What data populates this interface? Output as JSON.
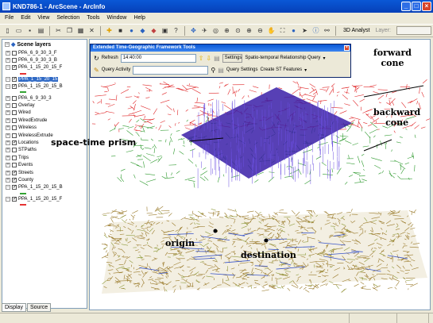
{
  "window": {
    "title": "KND786-1 - ArcScene - ArcInfo"
  },
  "menu": [
    "File",
    "Edit",
    "View",
    "Selection",
    "Tools",
    "Window",
    "Help"
  ],
  "toolbar": {
    "icons": [
      "new-document-icon",
      "open-icon",
      "save-icon",
      "print-icon",
      "cut-icon",
      "copy-icon",
      "paste-icon",
      "delete-icon",
      "add-data-icon",
      "stop-icon",
      "globe-icon",
      "layer-icon",
      "layer2-icon",
      "toggle-icon",
      "whats-this-icon",
      "navigate-icon",
      "fly-icon",
      "target-icon",
      "zoom-target-icon",
      "center-icon",
      "zoom-in-icon",
      "zoom-out-icon",
      "pan-icon",
      "full-extent-icon",
      "select-icon",
      "identify-icon",
      "binoculars-icon"
    ],
    "analyst_label": "3D Analyst",
    "layer_label": "Layer:"
  },
  "toc": {
    "header": "Scene layers",
    "rows": [
      {
        "label": "PPA_6_9_30_3_F",
        "checked": false,
        "expand": true,
        "selected": false
      },
      {
        "label": "PPA_6_9_30_3_B",
        "checked": false,
        "expand": true,
        "selected": false
      },
      {
        "label": "PPA_1_15_20_15_F",
        "checked": true,
        "expand": false,
        "selected": false,
        "swatch": "#e63333"
      },
      {
        "label": "PPA_1_15_20_15",
        "checked": true,
        "expand": false,
        "selected": true
      },
      {
        "label": "PPA_1_15_20_15_B",
        "checked": true,
        "expand": false,
        "selected": false,
        "swatch": "#33a333"
      },
      {
        "label": "PPA_6_9_30_3",
        "checked": false,
        "expand": true,
        "selected": false
      },
      {
        "label": "Overlay",
        "checked": false,
        "expand": true,
        "selected": false
      },
      {
        "label": "Wired",
        "checked": false,
        "expand": true,
        "selected": false
      },
      {
        "label": "WiredExtrude",
        "checked": false,
        "expand": true,
        "selected": false
      },
      {
        "label": "Wireless",
        "checked": false,
        "expand": true,
        "selected": false
      },
      {
        "label": "WirelessExtrude",
        "checked": false,
        "expand": true,
        "selected": false
      },
      {
        "label": "Locations",
        "checked": true,
        "expand": true,
        "selected": false
      },
      {
        "label": "STPaths",
        "checked": false,
        "expand": true,
        "selected": false
      },
      {
        "label": "Trips",
        "checked": false,
        "expand": true,
        "selected": false
      },
      {
        "label": "Events",
        "checked": false,
        "expand": true,
        "selected": false
      },
      {
        "label": "Streets",
        "checked": true,
        "expand": true,
        "selected": false
      },
      {
        "label": "County",
        "checked": true,
        "expand": true,
        "selected": false
      },
      {
        "label": "PPA_1_15_20_15_B",
        "checked": true,
        "expand": false,
        "selected": false,
        "swatch": "#33a333"
      },
      {
        "label": "PPA_1_15_20_15_F",
        "checked": true,
        "expand": false,
        "selected": false,
        "swatch": "#e63333"
      }
    ],
    "tabs": [
      "Display",
      "Source"
    ]
  },
  "egt": {
    "title": "Extended Time-Geographic Framework Tools",
    "refresh_label": "Refresh",
    "time_value": "14:40:00",
    "settings_label": "Settings",
    "st_query_label": "Spatio-temporal Relationship Query",
    "query_activity_label": "Query Activity",
    "query_settings_label": "Query Settings",
    "create_features_label": "Create ST Features"
  },
  "annotations": {
    "forward": "forward\ncone",
    "backward": "backward\ncone",
    "prism": "space-time prism",
    "origin": "origin",
    "destination": "destination"
  },
  "colors": {
    "forward_cone": "#e0282a",
    "backward_cone": "#2e9a2e",
    "prism": "#3a1fa8",
    "streets": "#9a7a2a"
  }
}
